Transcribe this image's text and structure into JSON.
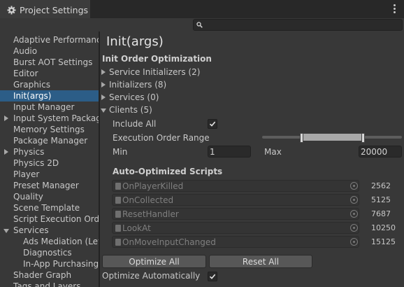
{
  "window": {
    "tab_title": "Project Settings"
  },
  "sidebar": {
    "items": [
      {
        "label": "Adaptive Performance"
      },
      {
        "label": "Audio"
      },
      {
        "label": "Burst AOT Settings"
      },
      {
        "label": "Editor"
      },
      {
        "label": "Graphics"
      },
      {
        "label": "Init(args)"
      },
      {
        "label": "Input Manager"
      },
      {
        "label": "Input System Package"
      },
      {
        "label": "Memory Settings"
      },
      {
        "label": "Package Manager"
      },
      {
        "label": "Physics"
      },
      {
        "label": "Physics 2D"
      },
      {
        "label": "Player"
      },
      {
        "label": "Preset Manager"
      },
      {
        "label": "Quality"
      },
      {
        "label": "Scene Template"
      },
      {
        "label": "Script Execution Order"
      },
      {
        "label": "Services"
      },
      {
        "label": "Ads Mediation (Levelplay)"
      },
      {
        "label": "Diagnostics"
      },
      {
        "label": "In-App Purchasing"
      },
      {
        "label": "Shader Graph"
      },
      {
        "label": "Tags and Layers"
      }
    ]
  },
  "main": {
    "title": "Init(args)",
    "section": "Init Order Optimization",
    "foldouts": [
      {
        "label": "Service Initializers (2)"
      },
      {
        "label": "Initializers (8)"
      },
      {
        "label": "Services (0)"
      },
      {
        "label": "Clients (5)"
      }
    ],
    "include_all_label": "Include All",
    "execution_order_label": "Execution Order Range",
    "min_label": "Min",
    "min_value": "1",
    "max_label": "Max",
    "max_value": "20000",
    "slider_range_fraction": [
      0.0,
      0.5
    ],
    "scripts_header": "Auto-Optimized Scripts",
    "scripts": [
      {
        "name": "OnPlayerKilled",
        "order": "2562"
      },
      {
        "name": "OnCollected",
        "order": "5125"
      },
      {
        "name": "ResetHandler",
        "order": "7687"
      },
      {
        "name": "LookAt",
        "order": "10250"
      },
      {
        "name": "OnMoveInputChanged",
        "order": "15125"
      }
    ],
    "optimize_all_label": "Optimize All",
    "reset_all_label": "Reset All",
    "optimize_auto_label": "Optimize Automatically"
  }
}
